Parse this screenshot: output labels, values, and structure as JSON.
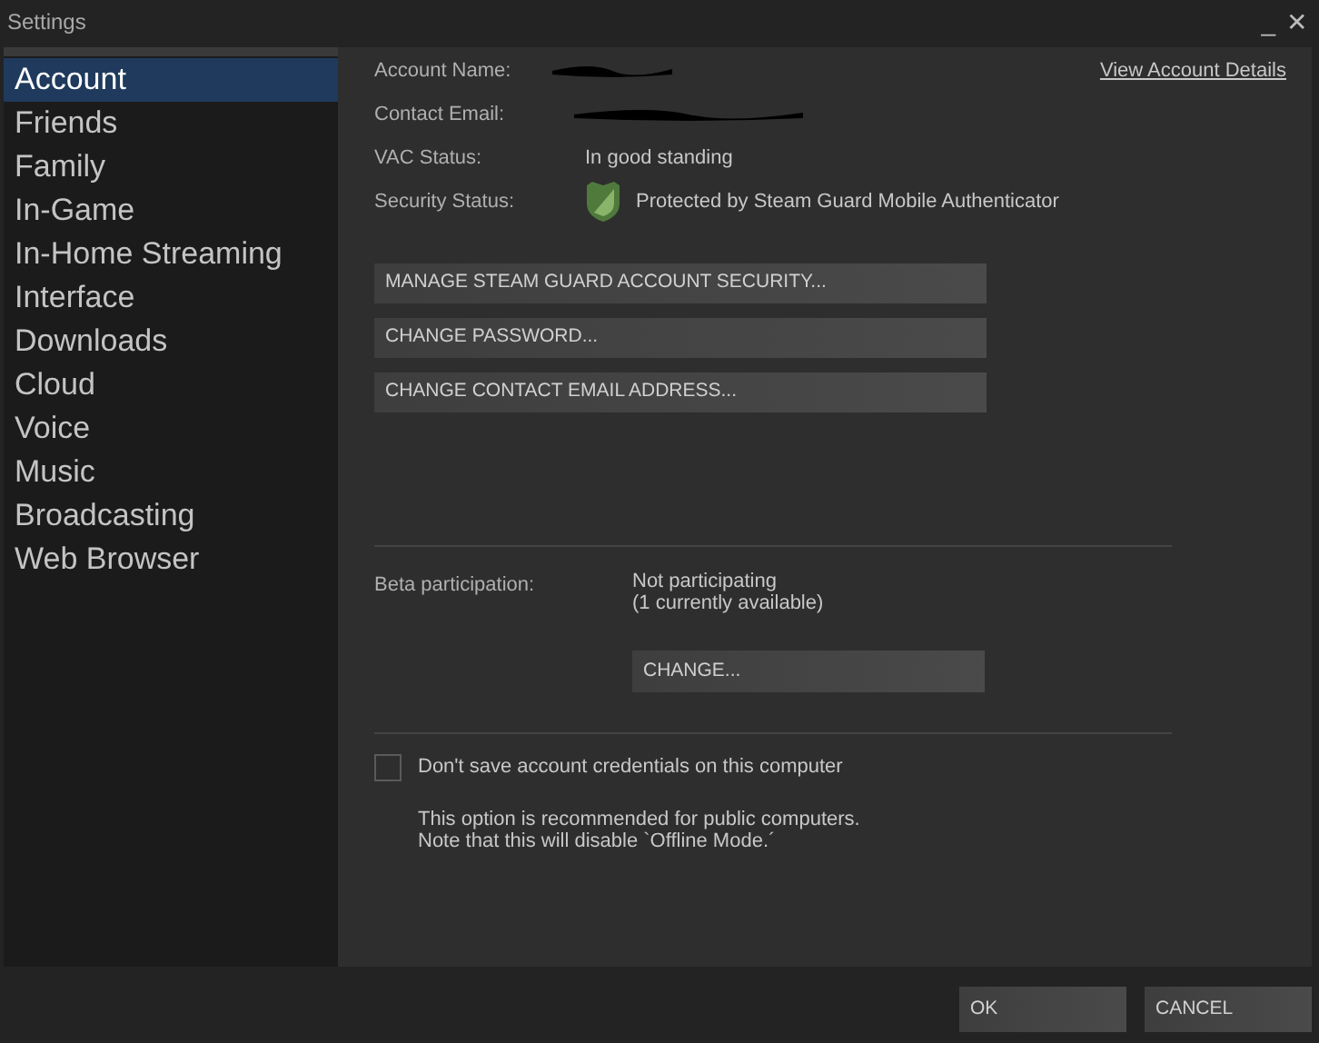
{
  "window": {
    "title": "Settings",
    "controls": [
      "_",
      "✕"
    ]
  },
  "sidebar": {
    "items": [
      {
        "label": "Account",
        "selected": true
      },
      {
        "label": "Friends",
        "selected": false
      },
      {
        "label": "Family",
        "selected": false
      },
      {
        "label": "In-Game",
        "selected": false
      },
      {
        "label": "In-Home Streaming",
        "selected": false
      },
      {
        "label": "Interface",
        "selected": false
      },
      {
        "label": "Downloads",
        "selected": false
      },
      {
        "label": "Cloud",
        "selected": false
      },
      {
        "label": "Voice",
        "selected": false
      },
      {
        "label": "Music",
        "selected": false
      },
      {
        "label": "Broadcasting",
        "selected": false
      },
      {
        "label": "Web Browser",
        "selected": false
      }
    ]
  },
  "account": {
    "view_link": "View Account Details",
    "fields": [
      {
        "label": "Account Name:",
        "kind": "redacted"
      },
      {
        "label": "Contact Email:",
        "kind": "redacted"
      },
      {
        "label": "VAC Status:",
        "kind": "text",
        "value": "In good standing"
      },
      {
        "label": "Security Status:",
        "kind": "shield",
        "value": "Protected by Steam Guard Mobile Authenticator"
      }
    ],
    "buttons": [
      "MANAGE STEAM GUARD ACCOUNT SECURITY...",
      "CHANGE PASSWORD...",
      "CHANGE CONTACT EMAIL ADDRESS..."
    ]
  },
  "beta": {
    "label": "Beta participation:",
    "value": [
      "Not participating",
      "(1 currently available)"
    ],
    "button": "CHANGE..."
  },
  "credentials": {
    "label": "Don't save account credentials on this computer",
    "checked": false,
    "note": [
      "This option is recommended for public computers.",
      "Note that this will disable `Offline Mode.´"
    ]
  },
  "footer": {
    "buttons": [
      "OK",
      "CANCEL"
    ]
  }
}
